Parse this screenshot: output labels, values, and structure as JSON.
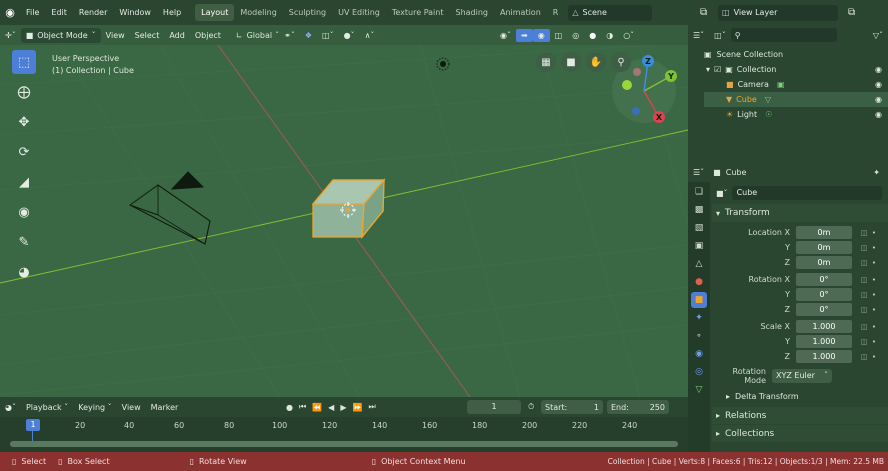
{
  "topbar": {
    "menus": [
      "File",
      "Edit",
      "Render",
      "Window",
      "Help"
    ],
    "workspaces": [
      "Layout",
      "Modeling",
      "Sculpting",
      "UV Editing",
      "Texture Paint",
      "Shading",
      "Animation",
      "R"
    ],
    "active_workspace": "Layout",
    "scene": "Scene",
    "view_layer": "View Layer"
  },
  "viewport_header": {
    "mode": "Object Mode",
    "menus": [
      "View",
      "Select",
      "Add",
      "Object"
    ],
    "transform_orientation": "Global"
  },
  "viewport": {
    "perspective_label": "User Perspective",
    "collection_label": "(1) Collection | Cube",
    "gizmo_axes": [
      "X",
      "Y",
      "Z"
    ]
  },
  "timeline": {
    "menus": [
      "Playback",
      "Keying",
      "View",
      "Marker"
    ],
    "current_frame": "1",
    "start_label": "Start:",
    "start": "1",
    "end_label": "End:",
    "end": "250",
    "ruler": [
      "20",
      "40",
      "60",
      "80",
      "100",
      "120",
      "140",
      "160",
      "180",
      "200",
      "220",
      "240"
    ],
    "playhead": "1"
  },
  "outliner": {
    "search_placeholder": "",
    "root": "Scene Collection",
    "collection": "Collection",
    "items": [
      {
        "label": "Camera"
      },
      {
        "label": "Cube"
      },
      {
        "label": "Light"
      }
    ]
  },
  "properties": {
    "object_name": "Cube",
    "datablock_name": "Cube",
    "transform_label": "Transform",
    "location": {
      "label": "Location X",
      "x": "0m",
      "y": "0m",
      "z": "0m"
    },
    "rotation": {
      "label": "Rotation X",
      "x": "0°",
      "y": "0°",
      "z": "0°"
    },
    "scale": {
      "label": "Scale X",
      "x": "1.000",
      "y": "1.000",
      "z": "1.000"
    },
    "axis_y": "Y",
    "axis_z": "Z",
    "rotation_mode_label": "Rotation Mode",
    "rotation_mode": "XYZ Euler",
    "delta_transform": "Delta Transform",
    "relations": "Relations",
    "collections": "Collections"
  },
  "statusbar": {
    "select": "Select",
    "box_select": "Box Select",
    "rotate_view": "Rotate View",
    "context_menu": "Object Context Menu",
    "stats": "Collection | Cube | Verts:8 | Faces:6 | Tris:12 | Objects:1/3 | Mem: 22.5 MB"
  },
  "colors": {
    "accent_blue": "#4d7ed8",
    "selection_orange": "#f0a52a",
    "x_axis": "#e04050",
    "y_axis": "#7fc232",
    "z_axis": "#3a8fdc",
    "status_bar": "#8b3230"
  }
}
